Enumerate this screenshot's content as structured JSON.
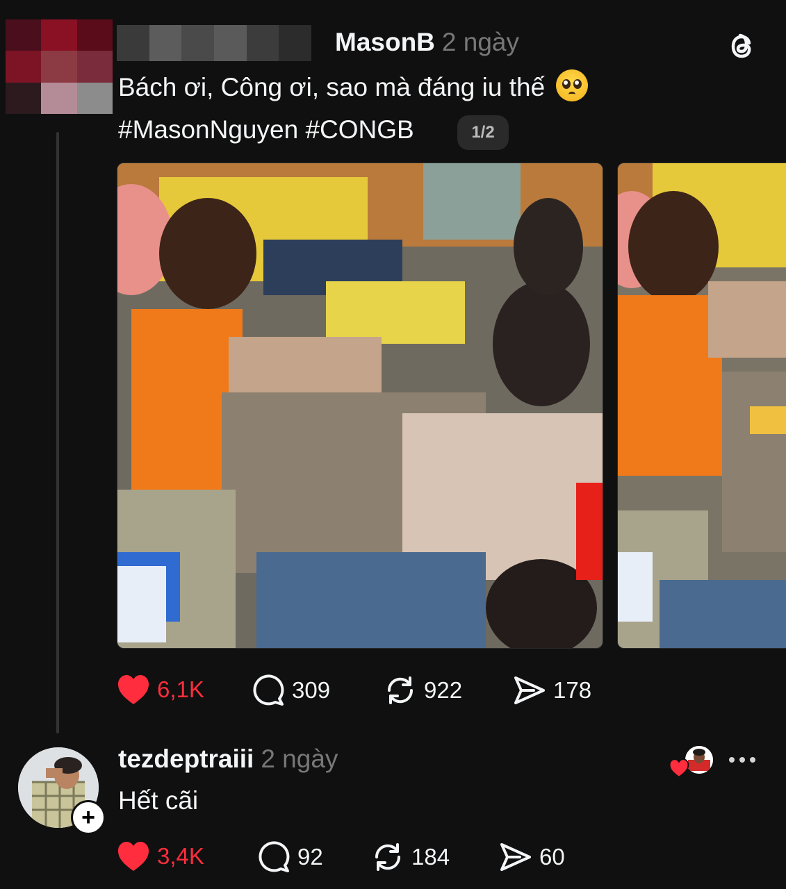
{
  "post": {
    "username": "MasonB",
    "time": "2 ngày",
    "text": "Bách ơi, Công ơi, sao mà đáng iu thế",
    "emoji_icon": "pleading-face-emoji",
    "hashtags": "#MasonNguyen #CONGB",
    "page_indicator": "1/2",
    "likes": "6,1K",
    "comments": "309",
    "reposts": "922",
    "shares": "178"
  },
  "reply": {
    "username": "tezdeptraiii",
    "time": "2 ngày",
    "text": "Hết cãi",
    "follow_label": "+",
    "likes": "3,4K",
    "comments": "92",
    "reposts": "184",
    "shares": "60"
  },
  "colors": {
    "background": "#101010",
    "like_red": "#ff2d3d",
    "muted": "#777777"
  }
}
